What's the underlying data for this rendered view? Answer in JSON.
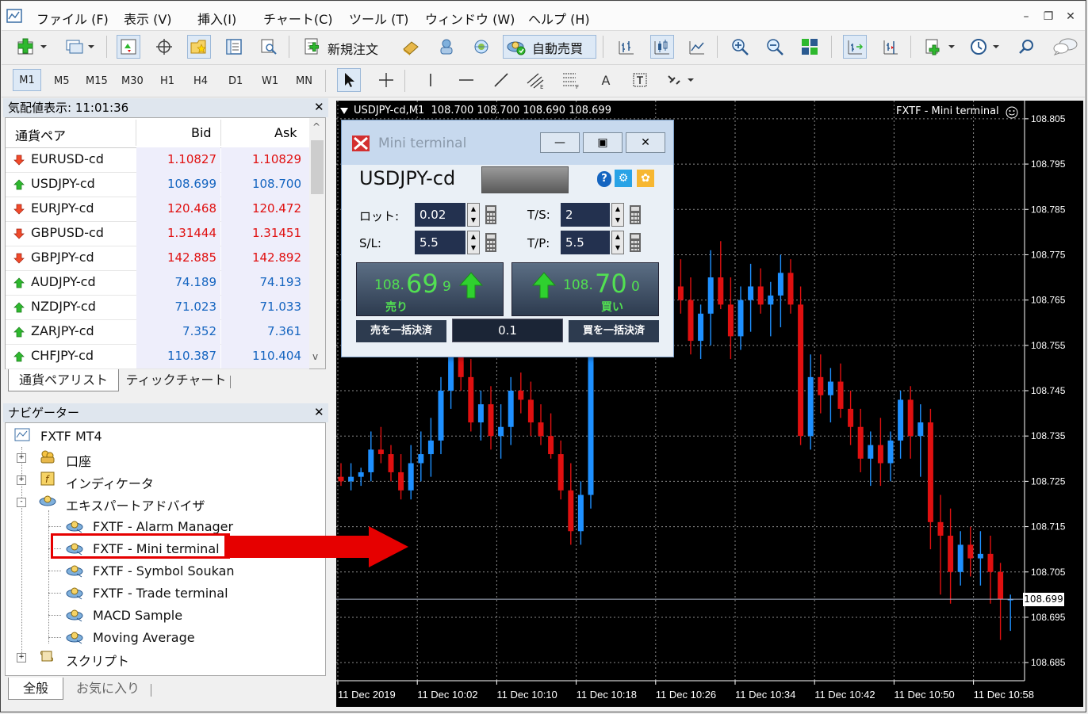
{
  "menu": {
    "items": [
      "ファイル (F)",
      "表示 (V)",
      "挿入(I)",
      "チャート(C)",
      "ツール (T)",
      "ウィンドウ (W)",
      "ヘルプ (H)"
    ]
  },
  "toolbar": {
    "new_order_label": "新規注文",
    "auto_trade_label": "自動売買",
    "timeframes": [
      "M1",
      "M5",
      "M15",
      "M30",
      "H1",
      "H4",
      "D1",
      "W1",
      "MN"
    ],
    "active_timeframe": "M1"
  },
  "market_watch": {
    "title": "気配値表示: 11:01:36",
    "col_symbol": "通貨ペア",
    "col_bid": "Bid",
    "col_ask": "Ask",
    "rows": [
      {
        "symbol": "EURUSD-cd",
        "bid": "1.10827",
        "ask": "1.10829",
        "dir": "down"
      },
      {
        "symbol": "USDJPY-cd",
        "bid": "108.699",
        "ask": "108.700",
        "dir": "up"
      },
      {
        "symbol": "EURJPY-cd",
        "bid": "120.468",
        "ask": "120.472",
        "dir": "down"
      },
      {
        "symbol": "GBPUSD-cd",
        "bid": "1.31444",
        "ask": "1.31451",
        "dir": "down"
      },
      {
        "symbol": "GBPJPY-cd",
        "bid": "142.885",
        "ask": "142.892",
        "dir": "down"
      },
      {
        "symbol": "AUDJPY-cd",
        "bid": "74.189",
        "ask": "74.193",
        "dir": "up"
      },
      {
        "symbol": "NZDJPY-cd",
        "bid": "71.023",
        "ask": "71.033",
        "dir": "up"
      },
      {
        "symbol": "ZARJPY-cd",
        "bid": "7.352",
        "ask": "7.361",
        "dir": "up"
      },
      {
        "symbol": "CHFJPY-cd",
        "bid": "110.387",
        "ask": "110.404",
        "dir": "up"
      }
    ],
    "tabs": [
      "通貨ペアリスト",
      "ティックチャート"
    ]
  },
  "navigator": {
    "title": "ナビゲーター",
    "root": "FXTF MT4",
    "groups": {
      "account": "口座",
      "indicators": "インディケータ",
      "experts": "エキスパートアドバイザ",
      "scripts": "スクリプト"
    },
    "experts": [
      "FXTF - Alarm Manager",
      "FXTF - Mini terminal",
      "FXTF - Symbol Soukan",
      "FXTF - Trade terminal",
      "MACD Sample",
      "Moving Average"
    ],
    "highlighted": "FXTF - Mini terminal",
    "tabs": [
      "全般",
      "お気に入り"
    ]
  },
  "chart": {
    "header": "USDJPY-cd,M1  108.700 108.700 108.690 108.699",
    "ea_label": "FXTF - Mini terminal",
    "current_price": "108.699",
    "colors": {
      "up": "#1e90ff",
      "down": "#e01010",
      "grid": "#8a8a8a",
      "bg": "#000000"
    }
  },
  "mini_terminal": {
    "title": "Mini terminal",
    "symbol": "USDJPY-cd",
    "lot_label": "ロット:",
    "lot": "0.02",
    "ts_label": "T/S:",
    "ts": "2",
    "sl_label": "S/L:",
    "sl": "5.5",
    "tp_label": "T/P:",
    "tp": "5.5",
    "sell": {
      "prefix": "108.",
      "big": "69",
      "small": "9",
      "label": "売り"
    },
    "buy": {
      "prefix": "108.",
      "big": "70",
      "small": "0",
      "label": "買い"
    },
    "close_sell": "売を一括決済",
    "close_buy": "買を一括決済",
    "spread": "0.1"
  },
  "chart_data": {
    "type": "candlestick",
    "price_axis": [
      "108.805",
      "108.795",
      "108.785",
      "108.775",
      "108.765",
      "108.755",
      "108.745",
      "108.735",
      "108.725",
      "108.715",
      "108.705",
      "108.695",
      "108.685"
    ],
    "time_axis": [
      "11 Dec 2019",
      "11 Dec 10:02",
      "11 Dec 10:10",
      "11 Dec 10:18",
      "11 Dec 10:26",
      "11 Dec 10:34",
      "11 Dec 10:42",
      "11 Dec 10:50",
      "11 Dec 10:58"
    ],
    "ylim": [
      108.681,
      108.809
    ],
    "candles": [
      [
        108.726,
        108.729,
        108.724,
        108.725
      ],
      [
        108.725,
        108.729,
        108.723,
        108.726
      ],
      [
        108.726,
        108.728,
        108.724,
        108.727
      ],
      [
        108.727,
        108.736,
        108.725,
        108.732
      ],
      [
        108.732,
        108.737,
        108.729,
        108.731
      ],
      [
        108.731,
        108.733,
        108.725,
        108.727
      ],
      [
        108.727,
        108.731,
        108.721,
        108.723
      ],
      [
        108.723,
        108.733,
        108.721,
        108.729
      ],
      [
        108.729,
        108.736,
        108.725,
        108.731
      ],
      [
        108.731,
        108.739,
        108.726,
        108.734
      ],
      [
        108.734,
        108.748,
        108.731,
        108.745
      ],
      [
        108.745,
        108.757,
        108.741,
        108.753
      ],
      [
        108.753,
        108.76,
        108.745,
        108.748
      ],
      [
        108.748,
        108.752,
        108.736,
        108.738
      ],
      [
        108.738,
        108.745,
        108.734,
        108.742
      ],
      [
        108.742,
        108.746,
        108.732,
        108.735
      ],
      [
        108.735,
        108.742,
        108.73,
        108.737
      ],
      [
        108.737,
        108.748,
        108.733,
        108.745
      ],
      [
        108.745,
        108.749,
        108.74,
        108.743
      ],
      [
        108.743,
        108.747,
        108.735,
        108.738
      ],
      [
        108.738,
        108.742,
        108.733,
        108.735
      ],
      [
        108.735,
        108.74,
        108.73,
        108.731
      ],
      [
        108.731,
        108.734,
        108.721,
        108.723
      ],
      [
        108.723,
        108.729,
        108.711,
        108.714
      ],
      [
        108.714,
        108.725,
        108.711,
        108.722
      ],
      [
        108.722,
        108.76,
        108.719,
        108.758
      ],
      [
        108.758,
        108.765,
        108.754,
        108.757
      ],
      [
        108.757,
        108.77,
        108.754,
        108.765
      ],
      [
        108.765,
        108.773,
        108.76,
        108.762
      ],
      [
        108.762,
        108.77,
        108.755,
        108.76
      ],
      [
        108.76,
        108.766,
        108.753,
        108.758
      ],
      [
        108.758,
        108.768,
        108.756,
        108.766
      ],
      [
        108.766,
        108.772,
        108.761,
        108.77
      ],
      [
        108.77,
        108.776,
        108.765,
        108.768
      ],
      [
        108.768,
        108.774,
        108.762,
        108.765
      ],
      [
        108.765,
        108.77,
        108.753,
        108.756
      ],
      [
        108.756,
        108.764,
        108.752,
        108.762
      ],
      [
        108.762,
        108.776,
        108.755,
        108.77
      ],
      [
        108.77,
        108.778,
        108.763,
        108.764
      ],
      [
        108.764,
        108.77,
        108.752,
        108.757
      ],
      [
        108.757,
        108.768,
        108.754,
        108.765
      ],
      [
        108.765,
        108.773,
        108.758,
        108.768
      ],
      [
        108.768,
        108.772,
        108.762,
        108.764
      ],
      [
        108.764,
        108.769,
        108.757,
        108.766
      ],
      [
        108.766,
        108.775,
        108.759,
        108.771
      ],
      [
        108.771,
        108.774,
        108.762,
        108.764
      ],
      [
        108.764,
        108.768,
        108.733,
        108.735
      ],
      [
        108.735,
        108.753,
        108.732,
        108.748
      ],
      [
        108.748,
        108.753,
        108.74,
        108.744
      ],
      [
        108.744,
        108.75,
        108.738,
        108.747
      ],
      [
        108.747,
        108.751,
        108.739,
        108.741
      ],
      [
        108.741,
        108.745,
        108.733,
        108.737
      ],
      [
        108.737,
        108.741,
        108.727,
        108.73
      ],
      [
        108.73,
        108.736,
        108.724,
        108.733
      ],
      [
        108.733,
        108.739,
        108.724,
        108.729
      ],
      [
        108.729,
        108.736,
        108.725,
        108.734
      ],
      [
        108.734,
        108.745,
        108.73,
        108.743
      ],
      [
        108.743,
        108.746,
        108.73,
        108.735
      ],
      [
        108.735,
        108.742,
        108.726,
        108.738
      ],
      [
        108.738,
        108.741,
        108.71,
        108.716
      ],
      [
        108.716,
        108.722,
        108.7,
        108.713
      ],
      [
        108.713,
        108.719,
        108.698,
        108.705
      ],
      [
        108.705,
        108.714,
        108.702,
        108.711
      ],
      [
        108.711,
        108.715,
        108.704,
        108.708
      ],
      [
        108.708,
        108.714,
        108.702,
        108.709
      ],
      [
        108.709,
        108.713,
        108.698,
        108.705
      ],
      [
        108.705,
        108.707,
        108.69,
        108.699
      ],
      [
        108.699,
        108.7,
        108.692,
        108.699
      ]
    ]
  }
}
